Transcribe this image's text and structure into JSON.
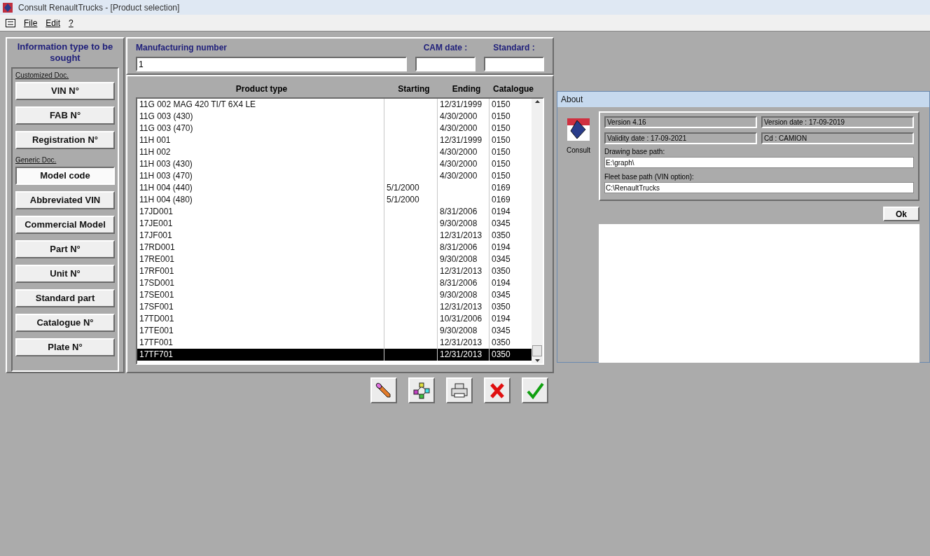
{
  "window": {
    "title": "Consult RenaultTrucks - [Product selection]"
  },
  "menu": [
    "File",
    "Edit",
    "?"
  ],
  "sidebar": {
    "title": "Information type to be sought",
    "groups": [
      {
        "label": "Customized Doc.",
        "buttons": [
          {
            "label": "VIN N°",
            "selected": false
          },
          {
            "label": "FAB N°",
            "selected": false
          },
          {
            "label": "Registration N°",
            "selected": false
          }
        ]
      },
      {
        "label": "Generic Doc.",
        "buttons": [
          {
            "label": "Model code",
            "selected": true
          },
          {
            "label": "Abbreviated VIN",
            "selected": false
          },
          {
            "label": "Commercial Model",
            "selected": false
          },
          {
            "label": "Part N°",
            "selected": false
          },
          {
            "label": "Unit N°",
            "selected": false
          },
          {
            "label": "Standard part",
            "selected": false
          },
          {
            "label": "Catalogue N°",
            "selected": false
          },
          {
            "label": "Plate N°",
            "selected": false
          }
        ]
      }
    ]
  },
  "search": {
    "manufacturing_number": {
      "label": "Manufacturing number",
      "value": "1"
    },
    "cam_date": {
      "label": "CAM date :"
    },
    "standard": {
      "label": "Standard :"
    }
  },
  "table": {
    "columns": [
      "Product type",
      "Starting",
      "Ending",
      "Catalogue"
    ],
    "rows": [
      {
        "cells": [
          "11G 002 MAG 420 TI/T 6X4 LE",
          "",
          "12/31/1999",
          "0150"
        ],
        "selected": false
      },
      {
        "cells": [
          "11G 003 (430)",
          "",
          "4/30/2000",
          "0150"
        ],
        "selected": false
      },
      {
        "cells": [
          "11G 003 (470)",
          "",
          "4/30/2000",
          "0150"
        ],
        "selected": false
      },
      {
        "cells": [
          "11H 001",
          "",
          "12/31/1999",
          "0150"
        ],
        "selected": false
      },
      {
        "cells": [
          "11H 002",
          "",
          "4/30/2000",
          "0150"
        ],
        "selected": false
      },
      {
        "cells": [
          "11H 003 (430)",
          "",
          "4/30/2000",
          "0150"
        ],
        "selected": false
      },
      {
        "cells": [
          "11H 003 (470)",
          "",
          "4/30/2000",
          "0150"
        ],
        "selected": false
      },
      {
        "cells": [
          "11H 004 (440)",
          "5/1/2000",
          "",
          "0169"
        ],
        "selected": false
      },
      {
        "cells": [
          "11H 004 (480)",
          "5/1/2000",
          "",
          "0169"
        ],
        "selected": false
      },
      {
        "cells": [
          "17JD001",
          "",
          "8/31/2006",
          "0194"
        ],
        "selected": false
      },
      {
        "cells": [
          "17JE001",
          "",
          "9/30/2008",
          "0345"
        ],
        "selected": false
      },
      {
        "cells": [
          "17JF001",
          "",
          "12/31/2013",
          "0350"
        ],
        "selected": false
      },
      {
        "cells": [
          "17RD001",
          "",
          "8/31/2006",
          "0194"
        ],
        "selected": false
      },
      {
        "cells": [
          "17RE001",
          "",
          "9/30/2008",
          "0345"
        ],
        "selected": false
      },
      {
        "cells": [
          "17RF001",
          "",
          "12/31/2013",
          "0350"
        ],
        "selected": false
      },
      {
        "cells": [
          "17SD001",
          "",
          "8/31/2006",
          "0194"
        ],
        "selected": false
      },
      {
        "cells": [
          "17SE001",
          "",
          "9/30/2008",
          "0345"
        ],
        "selected": false
      },
      {
        "cells": [
          "17SF001",
          "",
          "12/31/2013",
          "0350"
        ],
        "selected": false
      },
      {
        "cells": [
          "17TD001",
          "",
          "10/31/2006",
          "0194"
        ],
        "selected": false
      },
      {
        "cells": [
          "17TE001",
          "",
          "9/30/2008",
          "0345"
        ],
        "selected": false
      },
      {
        "cells": [
          "17TF001",
          "",
          "12/31/2013",
          "0350"
        ],
        "selected": false
      },
      {
        "cells": [
          "17TF701",
          "",
          "12/31/2013",
          "0350"
        ],
        "selected": true
      }
    ]
  },
  "toolbar": [
    {
      "kind": "pencil"
    },
    {
      "kind": "diagram"
    },
    {
      "kind": "printer"
    },
    {
      "kind": "cancel"
    },
    {
      "kind": "confirm"
    }
  ],
  "about": {
    "title": "About",
    "logo_label": "Consult",
    "version": "Version 4.16",
    "version_date": "Version date : 17-09-2019",
    "validity_date": "Validity date : 17-09-2021",
    "cd": "Cd : CAMION",
    "drawing_path": {
      "label": "Drawing base path:",
      "value": "E:\\graph\\"
    },
    "fleet_path": {
      "label": "Fleet base path (VIN option):",
      "value": "C:\\RenaultTrucks"
    },
    "ok": "Ok"
  }
}
